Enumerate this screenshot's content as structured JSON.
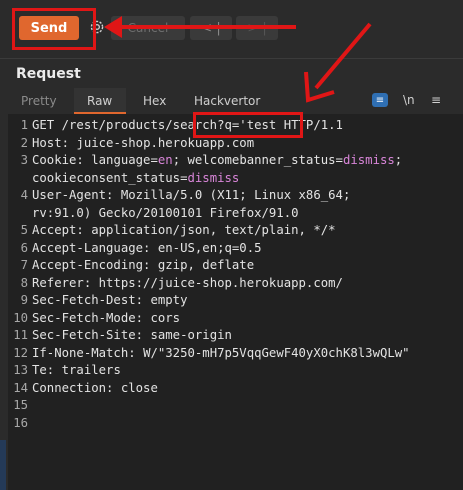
{
  "toolbar": {
    "send_label": "Send",
    "cancel_label": "Cancel",
    "prev_label": "< |",
    "next_label": "> |"
  },
  "request": {
    "title": "Request",
    "tabs": [
      "Pretty",
      "Raw",
      "Hex",
      "Hackvertor"
    ],
    "active_tab": "Raw",
    "newline_toggle_label": "\\n"
  },
  "editor": {
    "lines": [
      {
        "num": "1",
        "name": "GET /rest/products/search?q='test HTTP/1.1",
        "sep": "",
        "value": ""
      },
      {
        "num": "2",
        "name": "Host:",
        "sep": " ",
        "value": "juice-shop.herokuapp.com"
      },
      {
        "num": "3",
        "name": "Cookie:",
        "sep": " ",
        "value": "language=en; welcomebanner_status=dismiss;"
      },
      {
        "num": "",
        "name": "",
        "sep": "",
        "value": "cookieconsent_status=dismiss"
      },
      {
        "num": "4",
        "name": "User-Agent:",
        "sep": " ",
        "value": "Mozilla/5.0 (X11; Linux x86_64;"
      },
      {
        "num": "",
        "name": "",
        "sep": "",
        "value": "rv:91.0) Gecko/20100101 Firefox/91.0"
      },
      {
        "num": "5",
        "name": "Accept:",
        "sep": " ",
        "value": "application/json, text/plain, */*"
      },
      {
        "num": "6",
        "name": "Accept-Language:",
        "sep": " ",
        "value": "en-US,en;q=0.5"
      },
      {
        "num": "7",
        "name": "Accept-Encoding:",
        "sep": " ",
        "value": "gzip, deflate"
      },
      {
        "num": "8",
        "name": "Referer:",
        "sep": " ",
        "value": "https://juice-shop.herokuapp.com/"
      },
      {
        "num": "9",
        "name": "Sec-Fetch-Dest:",
        "sep": " ",
        "value": "empty"
      },
      {
        "num": "10",
        "name": "Sec-Fetch-Mode:",
        "sep": " ",
        "value": "cors"
      },
      {
        "num": "11",
        "name": "Sec-Fetch-Site:",
        "sep": " ",
        "value": "same-origin"
      },
      {
        "num": "12",
        "name": "If-None-Match:",
        "sep": " ",
        "value": "W/\"3250-mH7p5VqqGewF40yX0chK8l3wQLw\""
      },
      {
        "num": "13",
        "name": "Te:",
        "sep": " ",
        "value": "trailers"
      },
      {
        "num": "14",
        "name": "Connection:",
        "sep": " ",
        "value": "close"
      },
      {
        "num": "15",
        "name": "",
        "sep": "",
        "value": ""
      },
      {
        "num": "16",
        "name": "",
        "sep": "",
        "value": ""
      }
    ]
  },
  "colors": {
    "accent": "#e0672e",
    "annotation_red": "#e01616",
    "background": "#2b2b2b",
    "editor_bg": "#212121"
  }
}
